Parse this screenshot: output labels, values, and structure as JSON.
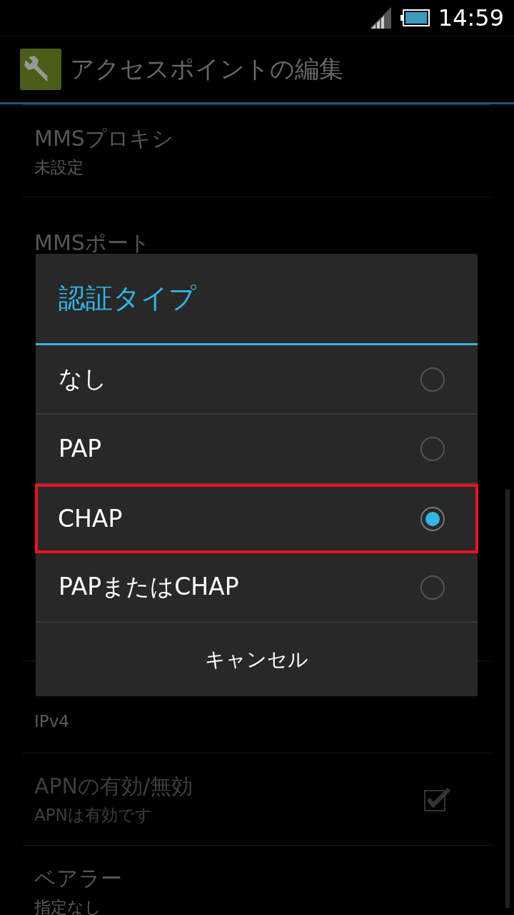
{
  "status_bar": {
    "time": "14:59"
  },
  "action_bar": {
    "title": "アクセスポイントの編集"
  },
  "settings_top": [
    {
      "title": "MMSプロキシ",
      "summary": "未設定"
    },
    {
      "title": "MMSポート"
    }
  ],
  "settings_bottom": [
    {
      "kind": "text",
      "summary": "IPv4",
      "disabled": false
    },
    {
      "kind": "checkbox",
      "title": "APNの有効/無効",
      "summary": "APNは有効です",
      "disabled": true,
      "checked": true
    },
    {
      "kind": "text",
      "title": "ベアラー",
      "summary": "指定なし",
      "disabled": false
    }
  ],
  "dialog": {
    "title": "認証タイプ",
    "options": [
      {
        "label": "なし",
        "selected": false,
        "highlighted": false
      },
      {
        "label": "PAP",
        "selected": false,
        "highlighted": false
      },
      {
        "label": "CHAP",
        "selected": true,
        "highlighted": true
      },
      {
        "label": "PAPまたはCHAP",
        "selected": false,
        "highlighted": false
      }
    ],
    "cancel": "キャンセル"
  }
}
